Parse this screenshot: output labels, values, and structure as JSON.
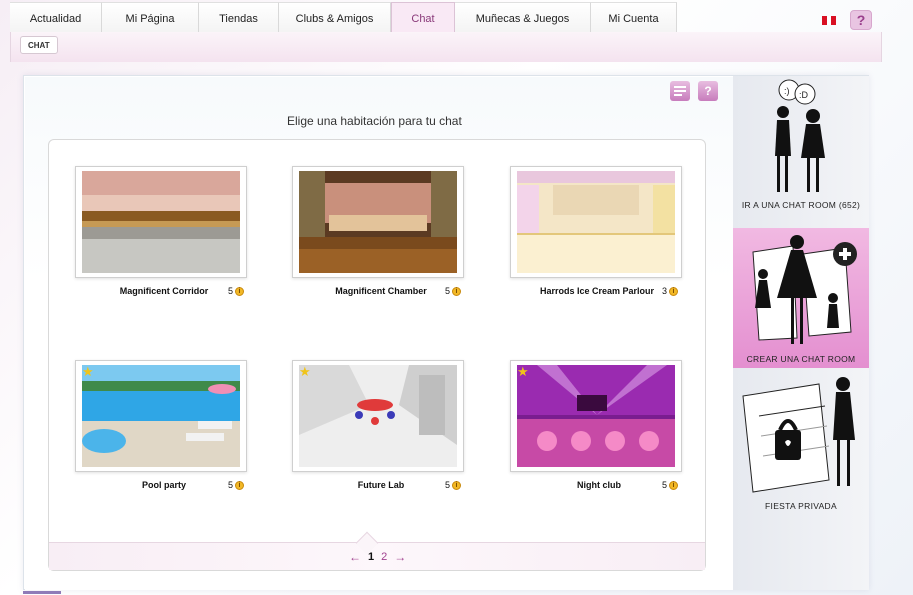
{
  "nav": {
    "tabs": [
      {
        "label": "Actualidad"
      },
      {
        "label": "Mi Página"
      },
      {
        "label": "Tiendas"
      },
      {
        "label": "Clubs & Amigos"
      },
      {
        "label": "Chat"
      },
      {
        "label": "Muñecas & Juegos"
      },
      {
        "label": "Mi Cuenta"
      }
    ],
    "active": "Chat",
    "help": "?"
  },
  "subnav": {
    "chip": "CHAT"
  },
  "main": {
    "heading": "Elige una habitación para tu chat",
    "help": "?",
    "rooms": [
      {
        "name": "Magnificent Corridor",
        "cost": "5",
        "starred": false
      },
      {
        "name": "Magnificent Chamber",
        "cost": "5",
        "starred": false
      },
      {
        "name": "Harrods Ice Cream Parlour",
        "cost": "3",
        "starred": false
      },
      {
        "name": "Pool party",
        "cost": "5",
        "starred": true
      },
      {
        "name": "Future Lab",
        "cost": "5",
        "starred": true
      },
      {
        "name": "Night club",
        "cost": "5",
        "starred": true
      }
    ],
    "pager": {
      "prev": "←",
      "current": "1",
      "other": "2",
      "next": "→"
    }
  },
  "sidebar": {
    "items": [
      {
        "label": "IR A UNA CHAT ROOM (652)"
      },
      {
        "label": "CREAR UNA CHAT ROOM"
      },
      {
        "label": "FIESTA PRIVADA"
      }
    ],
    "bubble_left": ":)",
    "bubble_right": ":D"
  },
  "colors": {
    "accent": "#a0408e",
    "highlight": "#e48fd0",
    "coin": "#f2b826"
  }
}
